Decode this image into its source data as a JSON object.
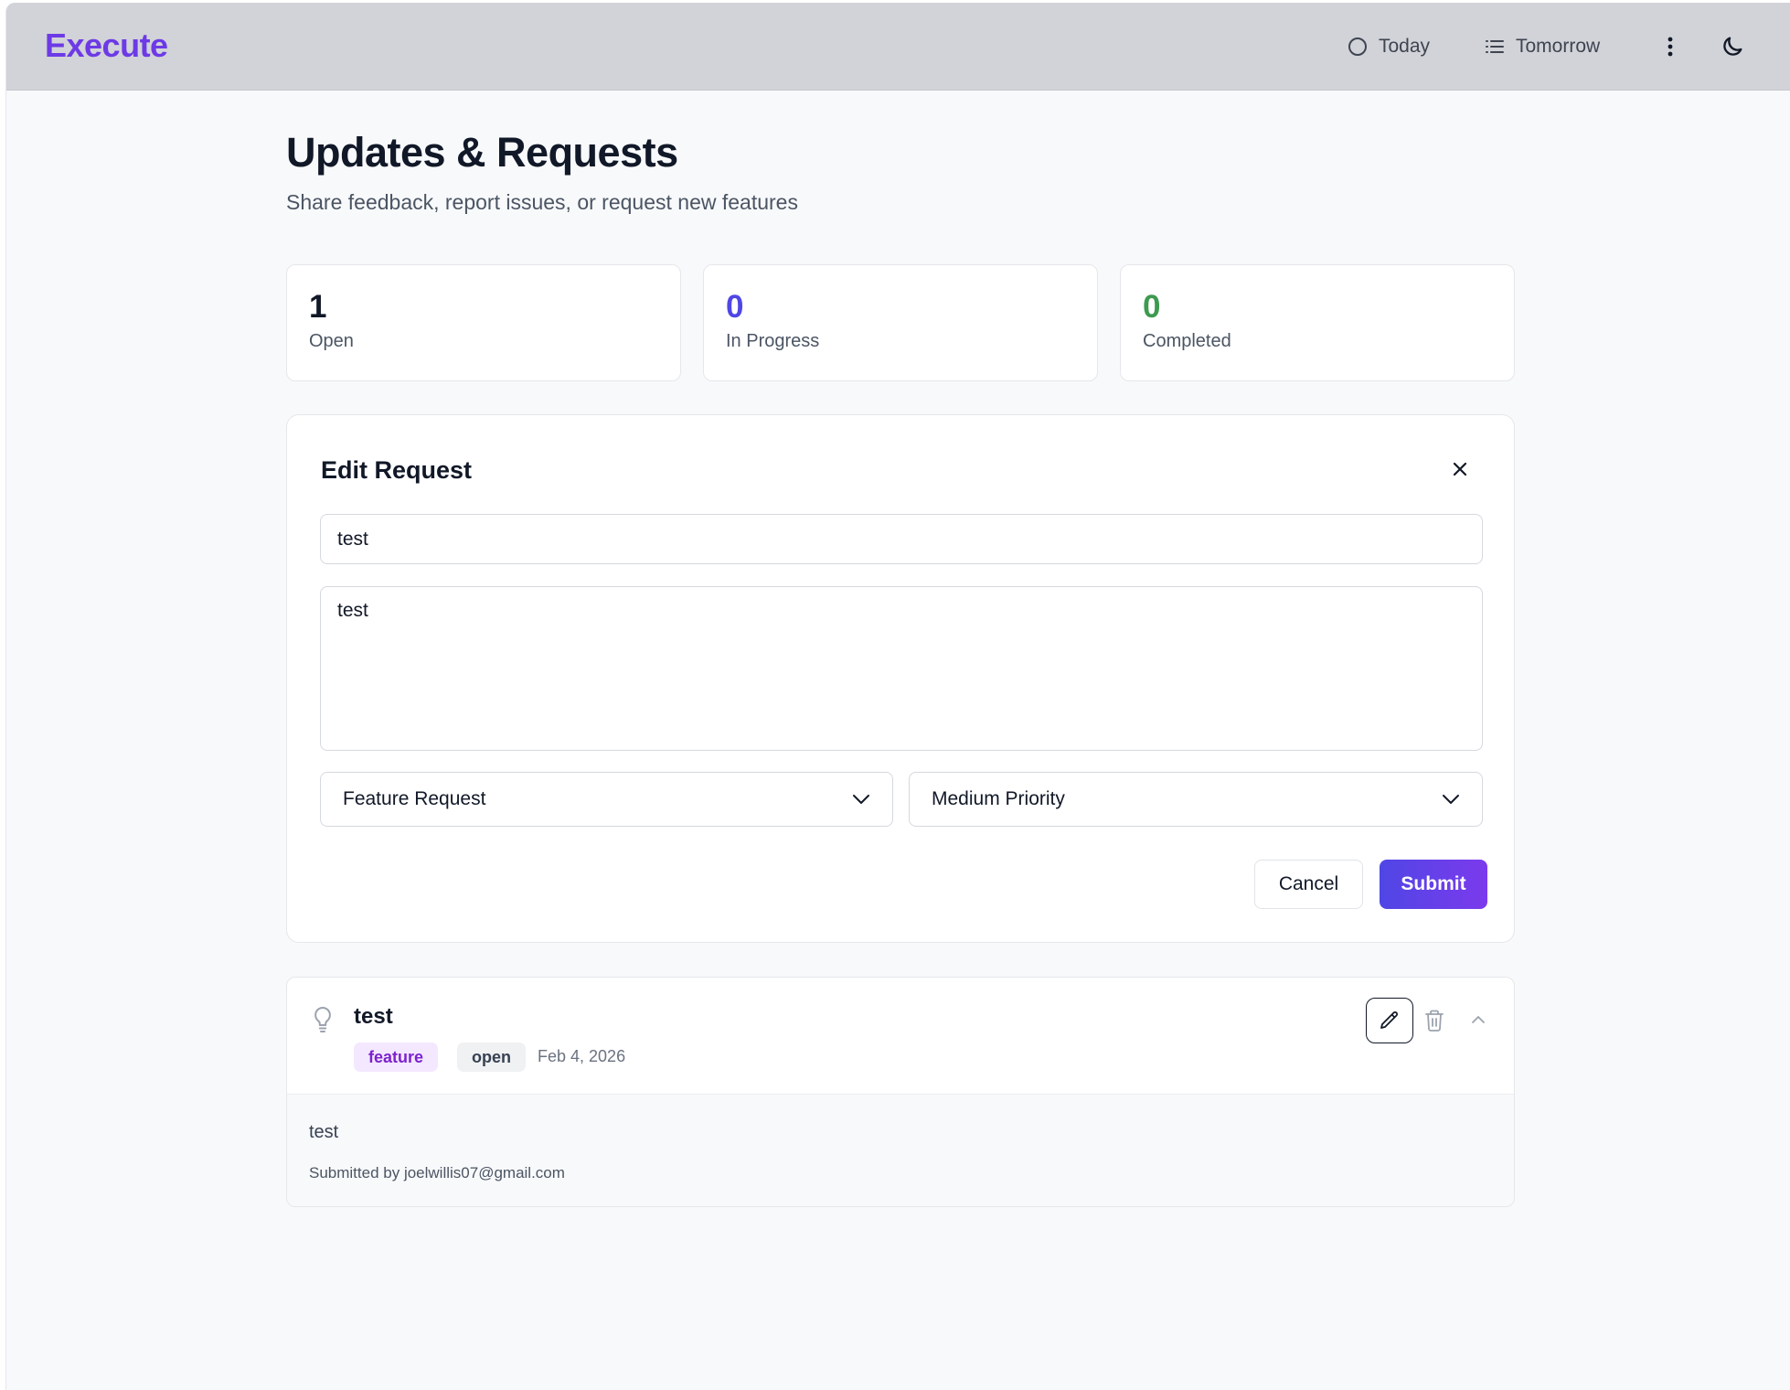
{
  "app": {
    "brand": "Execute",
    "brand_color": "#6d3ae6"
  },
  "header": {
    "nav": [
      {
        "label": "Today",
        "icon": "circle-icon"
      },
      {
        "label": "Tomorrow",
        "icon": "list-icon"
      }
    ],
    "more_icon": "more-vertical-icon",
    "theme_icon": "moon-icon"
  },
  "page": {
    "title": "Updates & Requests",
    "subtitle": "Share feedback, report issues, or request new features"
  },
  "stats": [
    {
      "value": "1",
      "label": "Open",
      "color": "#111827"
    },
    {
      "value": "0",
      "label": "In Progress",
      "color": "#4f46e5"
    },
    {
      "value": "0",
      "label": "Completed",
      "color": "#3d9a4f"
    }
  ],
  "edit_form": {
    "title": "Edit Request",
    "title_value": "test",
    "description_value": "test",
    "type_selected": "Feature Request",
    "priority_selected": "Medium Priority",
    "cancel_label": "Cancel",
    "submit_label": "Submit"
  },
  "requests": [
    {
      "title": "test",
      "type_badge": "feature",
      "status_badge": "open",
      "date": "Feb 4, 2026",
      "description": "test",
      "submitted_by": "Submitted by joelwillis07@gmail.com"
    }
  ]
}
